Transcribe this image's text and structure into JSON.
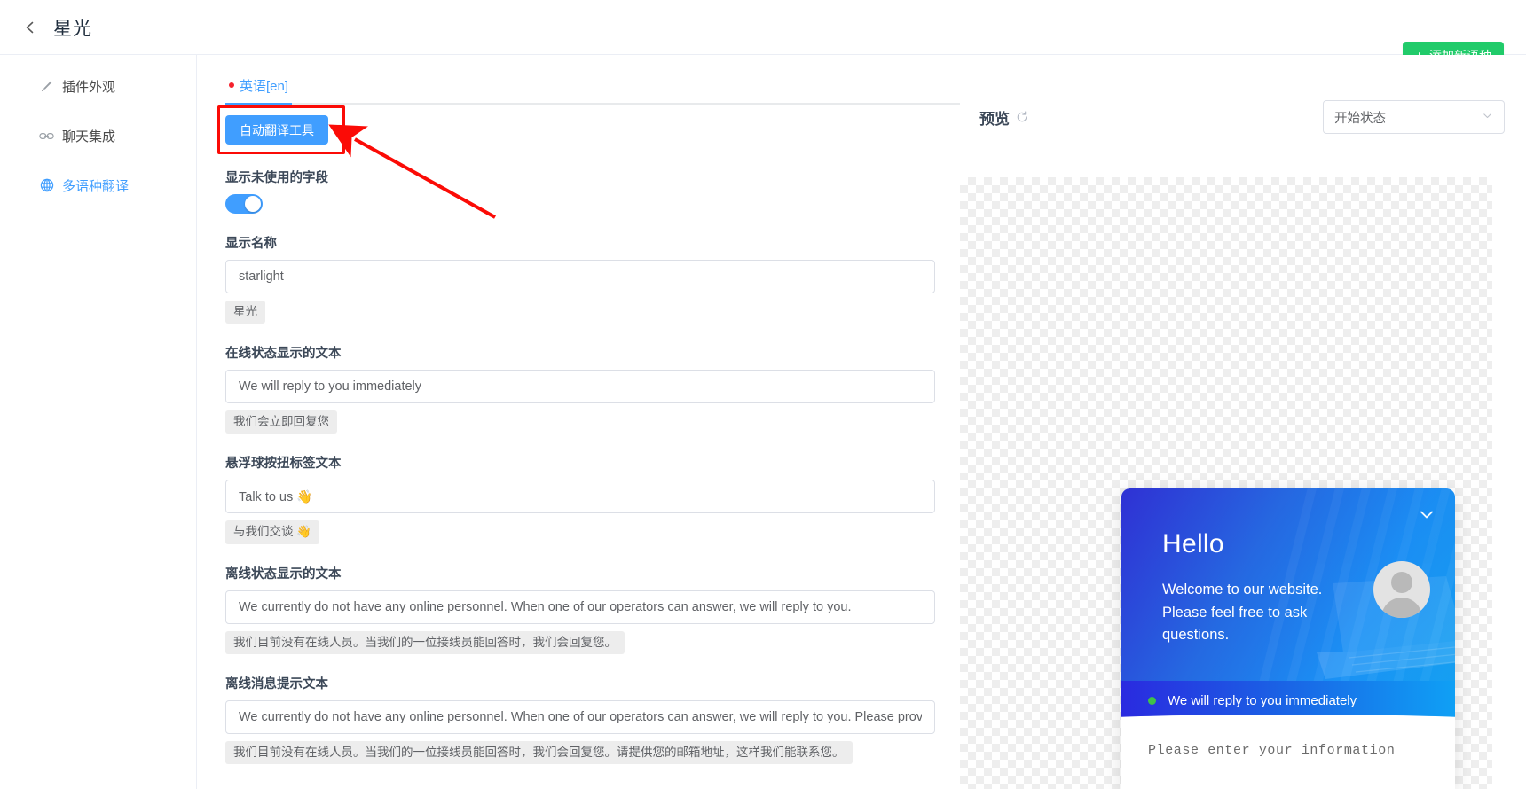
{
  "header": {
    "back_icon": "chevron-left-icon",
    "title": "星光"
  },
  "actions": {
    "add_language_label": "添加新语种",
    "add_language_plus": "+",
    "add_language_color": "#21cb6a"
  },
  "sidebar": {
    "items": [
      {
        "label": "插件外观",
        "icon": "brush-icon",
        "active": false
      },
      {
        "label": "聊天集成",
        "icon": "link-icon",
        "active": false
      },
      {
        "label": "多语种翻译",
        "icon": "globe-icon",
        "active": true
      }
    ]
  },
  "tabs": [
    {
      "label": "英语[en]",
      "active": true,
      "dot_color": "#f5222d"
    }
  ],
  "form": {
    "auto_translate_label": "自动翻译工具",
    "auto_translate_color": "#409eff",
    "highlight_color": "#fb0b06",
    "show_unused_label": "显示未使用的字段",
    "show_unused_on": true,
    "fields": [
      {
        "label": "显示名称",
        "value": "starlight",
        "hint": "星光"
      },
      {
        "label": "在线状态显示的文本",
        "value": "We will reply to you immediately",
        "hint": "我们会立即回复您"
      },
      {
        "label": "悬浮球按扭标签文本",
        "value": "Talk to us 👋",
        "hint": "与我们交谈 👋"
      },
      {
        "label": "离线状态显示的文本",
        "value": "We currently do not have any online personnel. When one of our operators can answer, we will reply to you.",
        "hint": "我们目前没有在线人员。当我们的一位接线员能回答时，我们会回复您。"
      },
      {
        "label": "离线消息提示文本",
        "value": "We currently do not have any online personnel. When one of our operators can answer, we will reply to you. Please provide",
        "hint": "我们目前没有在线人员。当我们的一位接线员能回答时，我们会回复您。请提供您的邮箱地址，这样我们能联系您。"
      }
    ]
  },
  "preview": {
    "title": "预览",
    "refresh_icon": "refresh-icon",
    "state_select_value": "开始状态",
    "caret_icon": "chevron-down-icon"
  },
  "chat_widget": {
    "collapse_icon": "chevron-down-icon",
    "greeting": "Hello",
    "welcome": "Welcome to our website. Please feel free to ask questions.",
    "status_text": "We will reply to you immediately",
    "status_dot_color": "#3fc14a",
    "input_placeholder": "Please enter your information",
    "avatar_icon": "user-avatar"
  }
}
